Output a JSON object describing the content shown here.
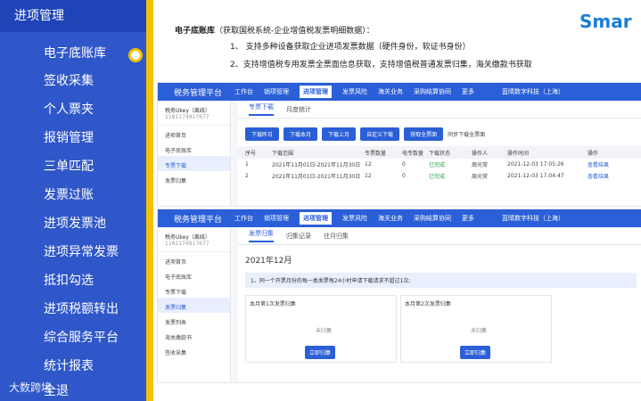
{
  "left": {
    "header": "进项管理",
    "items": [
      "电子底账库",
      "签收采集",
      "个人票夹",
      "报销管理",
      "三单匹配",
      "发票过账",
      "进项发票池",
      "进项异常发票",
      "抵扣勾选",
      "进项税额转出",
      "综合服务平台",
      "统计报表",
      "全退"
    ],
    "watermark": "大数跨境"
  },
  "desc": {
    "title": "电子底账库",
    "subtitle": "（获取国税系统-企业增值税发票明细数据）：",
    "line1": "1、  支持多种设备获取企业进项发票数据（硬件身份，软证书身份）",
    "line2": "2、支持增值税专用发票全票面信息获取，支持增值税普通发票归集，海关缴款书获取"
  },
  "logo": "Smar",
  "app1": {
    "brand": "税务管理平台",
    "nav": [
      "工作台",
      "销项管理",
      "进项管理",
      "发票风险",
      "海关业务",
      "采购结算协同",
      "更多"
    ],
    "active": "进项管理",
    "company": "蓝晴数字科技（上海）",
    "user": "用户1",
    "ukey": "税务Ukey（离线）",
    "ukey_no": "1181174917677",
    "menu": [
      "进项首页",
      "电子底账库",
      "专票下载",
      "发票归集"
    ],
    "tabs": [
      "专票下载",
      "月度统计"
    ],
    "buttons": [
      "下载昨日",
      "下载本月",
      "下载上月",
      "自定义下载",
      "获取全票面"
    ],
    "checkbox": "同步下载全票面",
    "columns": [
      "序号",
      "下载范围",
      "专票数量",
      "电专数量",
      "下载状态",
      "操作人",
      "操作时间",
      "操作"
    ],
    "rows": [
      [
        "1",
        "2021年11月01日-2021年11月30日",
        "12",
        "0",
        "已完成",
        "周光常",
        "2021-12-03 17:05:26",
        "查看结果"
      ],
      [
        "2",
        "2021年11月01日-2021年11月30日",
        "12",
        "0",
        "已完成",
        "周光常",
        "2021-12-03 17:04:47",
        "查看结果"
      ]
    ]
  },
  "app2": {
    "brand": "税务管理平台",
    "nav": [
      "工作台",
      "销项管理",
      "进项管理",
      "发票风险",
      "海关业务",
      "采购结算协同",
      "更多"
    ],
    "company": "蓝晴数字科技（上海）",
    "user": "用户1",
    "ukey": "税务Ukey（离线）",
    "ukey_no": "1181174917677",
    "menu": [
      "进项首页",
      "电子底账库",
      "专票下载",
      "发票归集",
      "发票列表",
      "海关缴款书",
      "签收采集"
    ],
    "tabs": [
      "发票归集",
      "归集记录",
      "往月归集"
    ],
    "month": "2021年12月",
    "tip": "1、同一个开票月份的每一类发票每24小时申请下载请求不超过1次;",
    "cards": [
      {
        "title": "本月第1次发票归集",
        "empty": "未归集",
        "button": "立即归集"
      },
      {
        "title": "本月第2次发票归集",
        "empty": "未归集",
        "button": "立即归集"
      }
    ]
  }
}
